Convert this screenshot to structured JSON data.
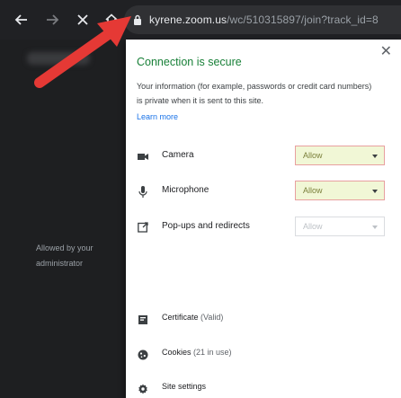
{
  "toolbar": {
    "icons": [
      "back-arrow-icon",
      "forward-arrow-icon",
      "close-icon",
      "home-icon"
    ],
    "url_host": "kyrene.zoom.us",
    "url_path": "/wc/510315897/join?track_id=8"
  },
  "popup": {
    "title": "Connection is secure",
    "description": "Your information (for example, passwords or credit card numbers) is private when it is sent to this site.",
    "learn_more": "Learn more",
    "permissions": [
      {
        "label": "Camera",
        "value": "Allow",
        "icon": "camera-icon"
      },
      {
        "label": "Microphone",
        "value": "Allow",
        "icon": "microphone-icon"
      },
      {
        "label": "Pop-ups and redirects",
        "value": "Allow",
        "icon": "popup-icon"
      }
    ],
    "popups_note": "Allowed by your administrator",
    "links": [
      {
        "label": "Certificate",
        "detail": "(Valid)",
        "icon": "certificate-icon"
      },
      {
        "label": "Cookies",
        "detail": "(21 in use)",
        "icon": "cookie-icon"
      },
      {
        "label": "Site settings",
        "detail": "",
        "icon": "gear-icon"
      }
    ]
  },
  "colors": {
    "secure_green": "#188038",
    "link_blue": "#1a73e8",
    "allow_highlight_bg": "#f1f7d6",
    "allow_highlight_border": "#e8a0a0",
    "annotation_arrow": "#e53935"
  }
}
